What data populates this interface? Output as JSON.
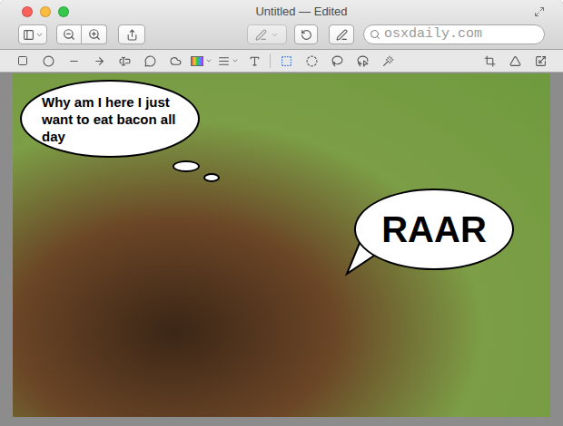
{
  "window": {
    "title": "Untitled — Edited"
  },
  "traffic_lights": [
    {
      "color": "#fc605c"
    },
    {
      "color": "#fdbc40"
    },
    {
      "color": "#34c84a"
    }
  ],
  "toolbar": {
    "highlight_button": {
      "disabled": true
    },
    "markup_button": {
      "selected": true
    },
    "search": {
      "text": "osxdaily.com"
    }
  },
  "edit_toolbar": {
    "selection_tool": {
      "selected": true
    }
  },
  "annotations": [
    {
      "kind": "thought",
      "text": "Why am I here I just want to eat bacon all day"
    },
    {
      "kind": "speech",
      "text": "RAAR"
    }
  ]
}
